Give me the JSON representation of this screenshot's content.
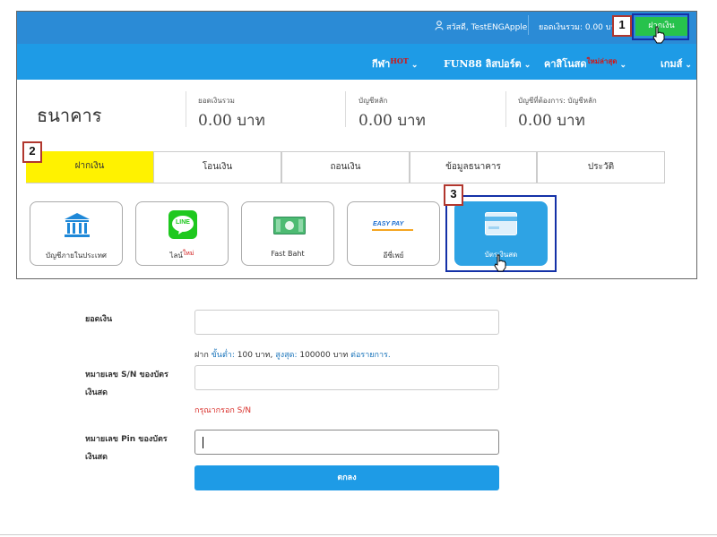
{
  "topbar": {
    "greeting": "สวัสดี, TestENGApple",
    "balance_label": "ยอดเงินรวม: 0.00 บาท",
    "deposit_button": "ฝากเงิน"
  },
  "nav": {
    "items": [
      {
        "label": "กีฬา",
        "tag": "HOT"
      },
      {
        "label": "FUN88 ลิสปอร์ต",
        "tag": ""
      },
      {
        "label": "คาสิโนสด",
        "tag": "ใหม่ล่าสุด"
      },
      {
        "label": "เกมส์",
        "tag": ""
      }
    ]
  },
  "bank": {
    "title": "ธนาคาร",
    "summary": [
      {
        "label": "ยอดเงินรวม",
        "value": "0.00 บาท"
      },
      {
        "label": "บัญชีหลัก",
        "value": "0.00 บาท"
      },
      {
        "label": "บัญชีที่ต้องการ: บัญชีหลัก",
        "value": "0.00 บาท"
      }
    ]
  },
  "tabs": [
    "ฝากเงิน",
    "โอนเงิน",
    "ถอนเงิน",
    "ข้อมูลธนาคาร",
    "ประวัติ"
  ],
  "methods": [
    {
      "label": "บัญชีภายในประเทศ",
      "icon": "bank-icon"
    },
    {
      "label": "ไลน์",
      "badge": "ใหม่",
      "icon": "line-icon",
      "logo_text": "LINE"
    },
    {
      "label": "Fast Baht",
      "icon": "banknote-icon"
    },
    {
      "label": "อีซี่เพย์",
      "icon": "easypay-icon",
      "logo_text": "EASY PAY"
    },
    {
      "label": "บัตรเงินสด",
      "icon": "cash-card-icon"
    }
  ],
  "step_badges": [
    "1",
    "2",
    "3"
  ],
  "form": {
    "amount_label": "ยอดเงิน",
    "hint_prefix": "ฝาก ",
    "hint_min_label": "ขั้นต่ำ:",
    "hint_min_value": " 100 บาท, ",
    "hint_max_label": "สูงสุด:",
    "hint_max_value": " 100000 บาท ",
    "hint_suffix": "ต่อรายการ.",
    "sn_label": "หมายเลข S/N ของบัตรเงินสด",
    "sn_error": "กรุณากรอก S/N",
    "pin_label": "หมายเลข Pin ของบัตรเงินสด",
    "submit_label": "ตกลง"
  },
  "colors": {
    "topbar": "#2b8bd6",
    "navbar": "#1e9be6",
    "deposit_green": "#27c24c",
    "active_tab": "#fff200",
    "selected_card": "#2ea3e4",
    "highlight_outline": "#1431a7",
    "badge_border": "#b1372e",
    "error": "#d9302b"
  }
}
